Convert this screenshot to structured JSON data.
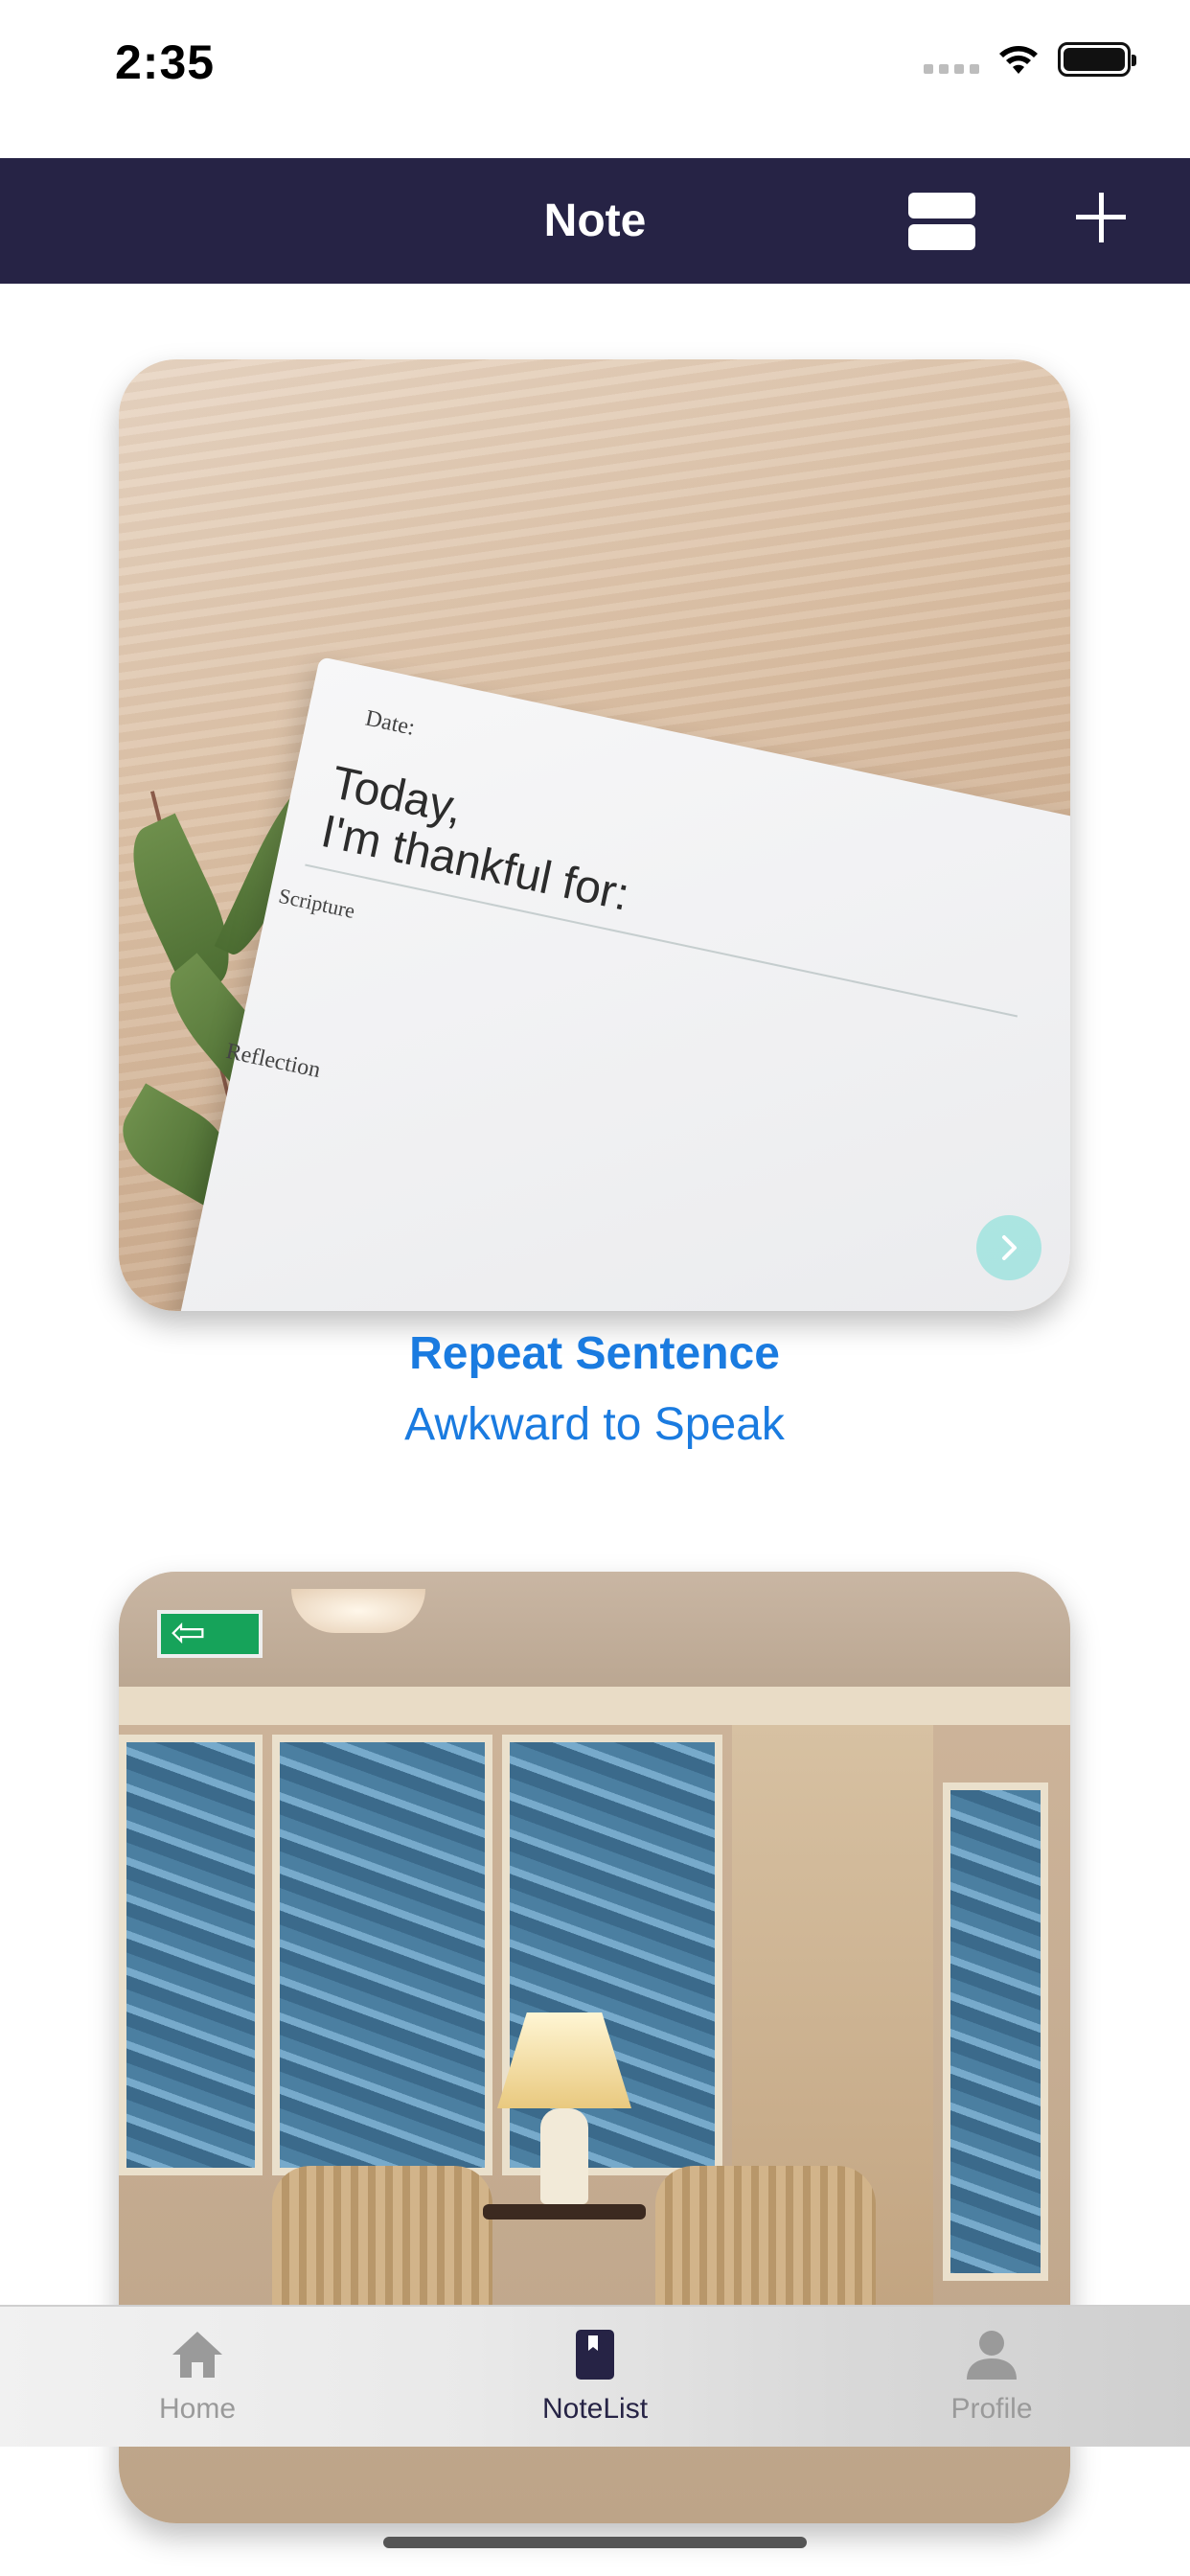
{
  "status_bar": {
    "time": "2:35"
  },
  "nav": {
    "title": "Note",
    "layout_toggle_icon": "view-list-icon",
    "add_icon": "plus-icon"
  },
  "notes": [
    {
      "title": "Repeat Sentence",
      "subtitle": "Awkward to Speak",
      "image_text": [
        "Date:",
        "Today,",
        "I'm thankful for:",
        "Scripture",
        "Reflection"
      ]
    },
    {
      "title": "",
      "subtitle": ""
    }
  ],
  "tabs": [
    {
      "label": "Home",
      "icon": "home-icon",
      "active": false
    },
    {
      "label": "NoteList",
      "icon": "book-icon",
      "active": true
    },
    {
      "label": "Profile",
      "icon": "person-icon",
      "active": false
    }
  ],
  "colors": {
    "nav_bg": "#262345",
    "accent": "#1a7be0",
    "tab_active": "#262345",
    "tab_inactive": "#9a9a9a"
  }
}
